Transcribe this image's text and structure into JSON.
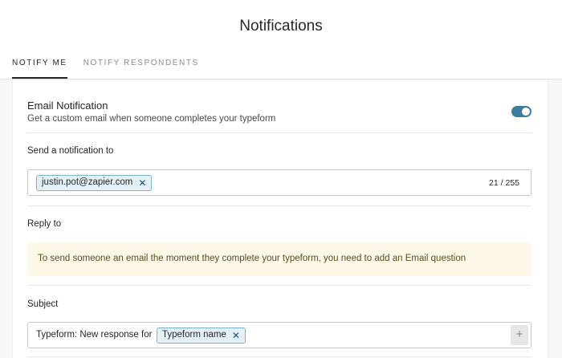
{
  "header": {
    "title": "Notifications",
    "tabs": [
      {
        "label": "NOTIFY ME",
        "active": true
      },
      {
        "label": "NOTIFY RESPONDENTS",
        "active": false
      }
    ]
  },
  "email_notification": {
    "title": "Email Notification",
    "description": "Get a custom email when someone completes your typeform",
    "enabled": true
  },
  "send_to": {
    "label": "Send a notification to",
    "recipients": [
      "justin.pot@zapier.com"
    ],
    "remove_icon": "close-icon",
    "counter": "21 / 255"
  },
  "reply_to": {
    "label": "Reply to",
    "notice": "To send someone an email the moment they complete your typeform, you need to add an Email question"
  },
  "subject": {
    "label": "Subject",
    "prefix": "Typeform: New response for",
    "variable": "Typeform name",
    "add_label": "+"
  },
  "colors": {
    "accent": "#3d7c9c",
    "chip_bg": "#e3f1f7",
    "chip_border": "#7fb3cc",
    "notice_bg": "#fdf8e8"
  }
}
